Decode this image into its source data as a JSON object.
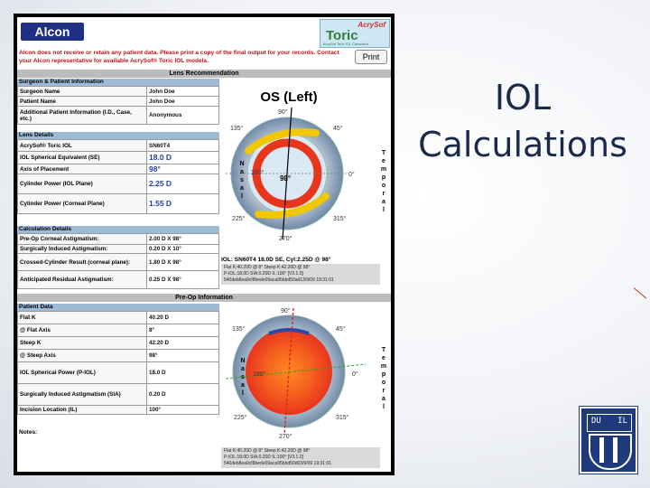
{
  "slide": {
    "title_line1": "IOL",
    "title_line2": "Calculations"
  },
  "logo": {
    "left_letters": "DU",
    "right_letters": "IL"
  },
  "header": {
    "brand": "Alcon",
    "product_super": "AcrySof",
    "product_name": "Toric",
    "product_sub": "AcrySof Toric IOL Calculator",
    "warning": "Alcon does not receive or retain any patient data. Please print a copy of the final output for your records. Contact your Alcon representative for available AcrySof® Toric IOL models.",
    "print_label": "Print"
  },
  "bands": {
    "lens_recommendation": "Lens Recommendation",
    "preop_information": "Pre-Op Information"
  },
  "sections": {
    "surgeon": "Surgeon & Patient Information",
    "lens": "Lens Details",
    "calc": "Calculation Details",
    "patient": "Patient Data"
  },
  "surgeon_rows": [
    {
      "k": "Surgeon Name",
      "v": "John Doe"
    },
    {
      "k": "Patient Name",
      "v": "John Doe"
    },
    {
      "k": "Additional Patient Information (I.D., Case, etc.)",
      "v": "Anonymous"
    }
  ],
  "lens_rows": [
    {
      "k": "AcrySof® Toric IOL",
      "v": "SN60T4"
    },
    {
      "k": "IOL Spherical Equivalent (SE)",
      "v": "18.0 D"
    },
    {
      "k": "Axis of Placement",
      "v": "98°"
    },
    {
      "k": "Cylinder Power (IOL Plane)",
      "v": "2.25 D"
    },
    {
      "k": "Cylinder Power (Corneal Plane)",
      "v": "1.55 D"
    }
  ],
  "calc_rows": [
    {
      "k": "Pre-Op Corneal Astigmatism:",
      "v": "2.00 D X 98°"
    },
    {
      "k": "Surgically Induced Astigmatism:",
      "v": "0.20 D X 10°"
    },
    {
      "k": "Crossed-Cylinder Result (corneal plane):",
      "v": "1.80 D X 98°"
    },
    {
      "k": "Anticipated Residual Astigmatism:",
      "v": "0.25 D X 98°"
    }
  ],
  "patient_rows": [
    {
      "k": "Flat K",
      "v": "40.20 D"
    },
    {
      "k": "@ Flat Axis",
      "v": "8°"
    },
    {
      "k": "Steep K",
      "v": "42.20 D"
    },
    {
      "k": "@ Steep Axis",
      "v": "98°"
    },
    {
      "k": "IOL Spherical Power (P-IOL)",
      "v": "18.0 D"
    },
    {
      "k": "Surgically Induced Astigmatism (SIA)",
      "v": "0.20 D"
    },
    {
      "k": "Incision Location (IL)",
      "v": "100°"
    }
  ],
  "notes_label": "Notes:",
  "diagram1": {
    "title": "OS (Left)",
    "deg_90": "90°",
    "deg_45": "45°",
    "deg_135": "135°",
    "deg_0": "0°",
    "deg_180": "180°",
    "deg_225": "225°",
    "deg_315": "315°",
    "deg_270": "270°",
    "axis_marker": "98°",
    "nasal": "Nasal",
    "temporal": "Temporal",
    "iol_line": "IOL: SN60T4  18.0D SE, Cyl:2.25D @ 98°",
    "grey_line1": "Flat K:40.20D @ 8°  Steep K:42.20D @ 98°",
    "grey_line2": "P-IOL:18.0D  SIA:0.20D  IL:100°  [V3.1.0]",
    "grey_line3": "540deb8ea9cf8bede09aca95bbd50ad13/9/09 19:31:01"
  },
  "diagram2": {
    "deg_90": "90°",
    "deg_45": "45°",
    "deg_135": "135°",
    "deg_0": "0°",
    "deg_180": "180°",
    "deg_225": "225°",
    "deg_315": "315°",
    "deg_270": "270°",
    "nasal": "Nasal",
    "temporal": "Temporal",
    "grey_line1": "Flat K:40.20D @ 8°  Steep K:42.20D @ 98°",
    "grey_line2": "P-IOL:18.0D  SIA:0.20D  IL:100°  [V3.1.0]",
    "grey_line3": "540deb8ea9cf8bede09aca95bbd50d03/9/09 19:31:01"
  },
  "colors": {
    "alcon_blue": "#1e2f86",
    "warning_red": "#c0141c",
    "section_blue": "#9fbad6",
    "value_blue": "#1f3fa0",
    "cornea_red": "#e8361d"
  }
}
